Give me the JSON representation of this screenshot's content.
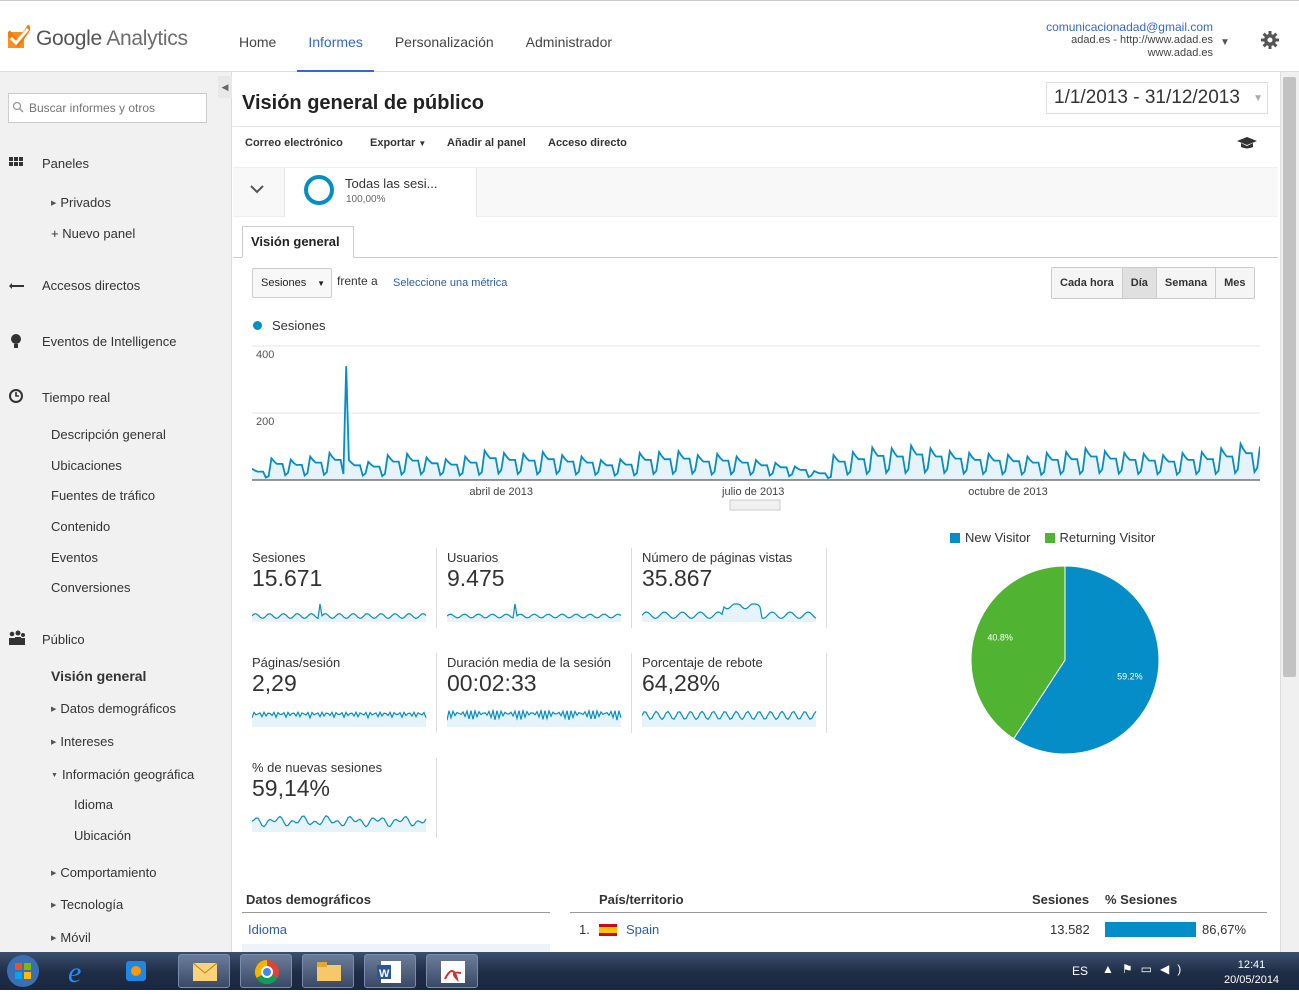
{
  "app": {
    "logo_google": "Google",
    "logo_analytics": "Analytics"
  },
  "nav": [
    {
      "label": "Home"
    },
    {
      "label": "Informes",
      "active": true
    },
    {
      "label": "Personalización"
    },
    {
      "label": "Administrador"
    }
  ],
  "account": {
    "email": "comunicacionadad@gmail.com",
    "property": "adad.es - http://www.adad.es",
    "view": "www.adad.es"
  },
  "sidebar": {
    "search_placeholder": "Buscar informes y otros",
    "sections": [
      {
        "label": "Paneles",
        "icon": "grid-icon"
      },
      {
        "label": "Accesos directos",
        "icon": "shortcut-icon"
      },
      {
        "label": "Eventos de Intelligence",
        "icon": "bulb-icon"
      },
      {
        "label": "Tiempo real",
        "icon": "clock-icon"
      },
      {
        "label": "Público",
        "icon": "people-icon"
      }
    ],
    "paneles_items": [
      "Privados",
      "+ Nuevo panel"
    ],
    "realtime_items": [
      "Descripción general",
      "Ubicaciones",
      "Fuentes de tráfico",
      "Contenido",
      "Eventos",
      "Conversiones"
    ],
    "audience_items": [
      "Visión general",
      "Datos demográficos",
      "Intereses",
      "Información geográfica",
      "Idioma",
      "Ubicación",
      "Comportamiento",
      "Tecnología",
      "Móvil"
    ]
  },
  "page": {
    "title": "Visión general de público",
    "date_range": "1/1/2013 - 31/12/2013",
    "toolbar": [
      "Correo electrónico",
      "Exportar",
      "Añadir al panel",
      "Acceso directo"
    ],
    "segment": {
      "name": "Todas las sesi...",
      "pct": "100,00%"
    },
    "tab": "Visión general",
    "metric": "Sesiones",
    "vs": "frente a",
    "vs_link": "Seleccione una métrica",
    "granularity": [
      "Cada hora",
      "Día",
      "Semana",
      "Mes"
    ],
    "granularity_active": "Día"
  },
  "chart_data": [
    {
      "type": "area",
      "series": [
        {
          "name": "Sesiones",
          "color": "#058dc7"
        }
      ],
      "ylim": [
        0,
        400
      ],
      "yticks": [
        "400",
        "200"
      ],
      "xticks": [
        "abril de 2013",
        "julio de 2013",
        "octubre de 2013"
      ],
      "weekly_avg": [
        25,
        48,
        45,
        52,
        60,
        44,
        40,
        55,
        58,
        50,
        46,
        52,
        65,
        60,
        58,
        62,
        55,
        52,
        44,
        46,
        60,
        62,
        64,
        55,
        58,
        52,
        44,
        38,
        30,
        20,
        55,
        62,
        72,
        70,
        76,
        70,
        64,
        60,
        58,
        56,
        52,
        60,
        62,
        70,
        64,
        60,
        58,
        55,
        60,
        62,
        70,
        80,
        74
      ],
      "spike": {
        "date": "2013-02-04",
        "value": 340
      }
    },
    {
      "type": "pie",
      "labels": [
        "New Visitor",
        "Returning Visitor"
      ],
      "values": [
        59.2,
        40.8
      ],
      "colors": [
        "#058dc7",
        "#50b432"
      ],
      "data_labels": [
        "59.2%",
        "40.8%"
      ]
    }
  ],
  "summary": [
    {
      "label": "Sesiones",
      "value": "15.671"
    },
    {
      "label": "Usuarios",
      "value": "9.475"
    },
    {
      "label": "Número de páginas vistas",
      "value": "35.867"
    },
    {
      "label": "Páginas/sesión",
      "value": "2,29"
    },
    {
      "label": "Duración media de la sesión",
      "value": "00:02:33"
    },
    {
      "label": "Porcentaje de rebote",
      "value": "64,28%"
    },
    {
      "label": "% de nuevas sesiones",
      "value": "59,14%"
    }
  ],
  "demographics": {
    "header": "Datos demográficos",
    "row": "Idioma"
  },
  "country_table": {
    "headers": [
      "País/territorio",
      "Sesiones",
      "% Sesiones"
    ],
    "rows": [
      {
        "rank": "1.",
        "country": "Spain",
        "sessions": "13.582",
        "pct": "86,67%",
        "pct_value": 86.67
      }
    ]
  },
  "taskbar": {
    "lang": "ES",
    "time": "12:41",
    "date": "20/05/2014"
  }
}
